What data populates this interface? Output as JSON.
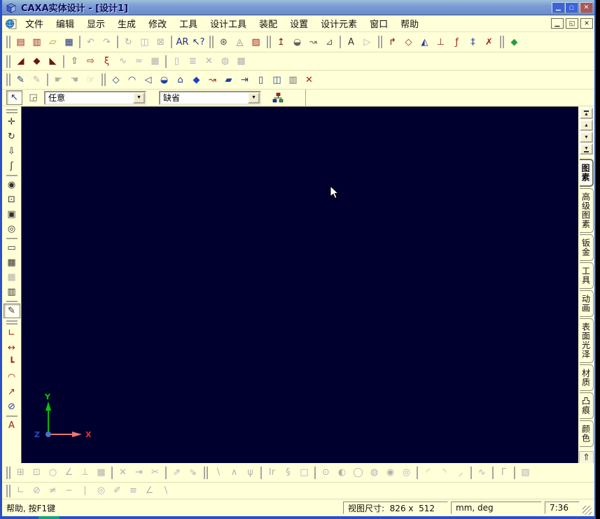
{
  "window": {
    "title": "CAXA实体设计 - [设计1]"
  },
  "titlebar_buttons": [
    {
      "n": "window-minimize",
      "g": "▁"
    },
    {
      "n": "window-maximize",
      "g": "□"
    },
    {
      "n": "window-close",
      "g": "✕"
    }
  ],
  "menubar": {
    "items": [
      {
        "name": "file",
        "label": "文件"
      },
      {
        "name": "edit",
        "label": "编辑"
      },
      {
        "name": "display",
        "label": "显示"
      },
      {
        "name": "generate",
        "label": "生成"
      },
      {
        "name": "modify",
        "label": "修改"
      },
      {
        "name": "tools",
        "label": "工具"
      },
      {
        "name": "design-tools",
        "label": "设计工具"
      },
      {
        "name": "assembly",
        "label": "装配"
      },
      {
        "name": "settings",
        "label": "设置"
      },
      {
        "name": "design-elements",
        "label": "设计元素"
      },
      {
        "name": "window",
        "label": "窗口"
      },
      {
        "name": "help",
        "label": "帮助"
      }
    ],
    "child_buttons": [
      {
        "n": "document-minimize",
        "g": "▁"
      },
      {
        "n": "document-restore",
        "g": "◱"
      },
      {
        "n": "document-close",
        "g": "✕"
      }
    ]
  },
  "toolbars": {
    "standard": [
      {
        "t": "grip"
      },
      {
        "n": "new-design",
        "g": "▤",
        "c": "#a02020"
      },
      {
        "n": "new-drawing",
        "g": "▥",
        "c": "#a02020"
      },
      {
        "n": "open-file",
        "g": "▱",
        "c": "#c09020"
      },
      {
        "n": "save-file",
        "g": "▦",
        "c": "#203080"
      },
      {
        "t": "sep"
      },
      {
        "n": "undo",
        "g": "↶",
        "d": true
      },
      {
        "n": "redo",
        "g": "↷",
        "d": true
      },
      {
        "t": "sep"
      },
      {
        "n": "update-links",
        "g": "↻",
        "d": true
      },
      {
        "n": "copy-multiple",
        "g": "◫",
        "d": true
      },
      {
        "n": "lock-part",
        "g": "⊠",
        "d": true
      },
      {
        "t": "sep"
      },
      {
        "n": "find",
        "g": "AR",
        "c": "#203080"
      },
      {
        "n": "context-help",
        "g": "↖?",
        "c": "#203080"
      },
      {
        "t": "grip"
      },
      {
        "n": "render-options",
        "g": "⊛",
        "c": "#505050"
      },
      {
        "n": "smart-render",
        "g": "◬",
        "c": "#808080"
      },
      {
        "n": "render-scene",
        "g": "▨",
        "c": "#a02020"
      },
      {
        "t": "grip"
      },
      {
        "n": "extrude-wizard",
        "g": "↥",
        "c": "#801010"
      },
      {
        "n": "revolve-wizard",
        "g": "◒",
        "c": "#606060"
      },
      {
        "n": "sweep-wizard",
        "g": "↝",
        "c": "#606060"
      },
      {
        "n": "loft-wizard",
        "g": "⊿",
        "c": "#606060"
      },
      {
        "t": "sep"
      },
      {
        "n": "text-wizard",
        "g": "A",
        "c": "#303030"
      },
      {
        "n": "sketch-wizard",
        "g": "▷",
        "d": true
      },
      {
        "t": "grip"
      },
      {
        "n": "bend-tool",
        "g": "↱",
        "c": "#801010"
      },
      {
        "n": "shell-tool",
        "g": "◇",
        "c": "#a02020"
      },
      {
        "n": "mirror-tool",
        "g": "◭",
        "c": "#2040a0"
      },
      {
        "n": "face-move-tool",
        "g": "⊥",
        "c": "#a02020"
      },
      {
        "n": "equation-tool",
        "g": "ƒ",
        "c": "#a02020"
      },
      {
        "n": "smart-dimension",
        "g": "‡",
        "c": "#2040a0"
      },
      {
        "n": "remove-material",
        "g": "✗",
        "c": "#a02020"
      },
      {
        "t": "grip"
      },
      {
        "n": "surface-tool",
        "g": "◆",
        "c": "#20a040"
      }
    ],
    "feature": [
      {
        "t": "grip"
      },
      {
        "n": "extrude-feature",
        "g": "◢",
        "c": "#6b1515"
      },
      {
        "n": "revolve-feature",
        "g": "◆",
        "c": "#6b1515"
      },
      {
        "n": "sweep-feature",
        "g": "◣",
        "c": "#6b1515"
      },
      {
        "t": "sep"
      },
      {
        "n": "stamp-feature",
        "g": "⇧",
        "c": "#555555"
      },
      {
        "n": "draft-feature",
        "g": "⇨",
        "c": "#a02020"
      },
      {
        "n": "spring-feature",
        "g": "ξ",
        "c": "#a02020"
      },
      {
        "n": "surface-feature-1",
        "g": "∿",
        "d": true
      },
      {
        "n": "surface-feature-2",
        "g": "≈",
        "d": true
      },
      {
        "n": "surface-feature-3",
        "g": "▦",
        "d": true
      },
      {
        "t": "sep"
      },
      {
        "n": "new-sheet",
        "g": "▯",
        "d": true
      },
      {
        "n": "sheet-stack",
        "g": "≣",
        "d": true
      },
      {
        "n": "split-tool",
        "g": "✕",
        "d": true
      },
      {
        "n": "shade-tool",
        "g": "◍",
        "d": true
      },
      {
        "n": "pattern-tool",
        "g": "▩",
        "d": true
      }
    ],
    "wireframe": [
      {
        "t": "grip"
      },
      {
        "n": "sketch-2d",
        "g": "✎",
        "c": "#203080"
      },
      {
        "n": "sketch-3d",
        "g": "✎",
        "d": true
      },
      {
        "t": "sep"
      },
      {
        "n": "drag-handle-1",
        "g": "☛",
        "d": true
      },
      {
        "n": "drag-handle-2",
        "g": "☚",
        "d": true
      },
      {
        "n": "drag-handle-3",
        "g": "☞",
        "d": true
      },
      {
        "t": "grip"
      },
      {
        "n": "wire-box",
        "g": "◇",
        "c": "#2040a0"
      },
      {
        "n": "wire-cylinder",
        "g": "◠",
        "c": "#2040a0"
      },
      {
        "n": "wire-wedge",
        "g": "◁",
        "c": "#2040a0"
      },
      {
        "n": "wire-vase",
        "g": "◒",
        "c": "#2040a0"
      },
      {
        "n": "wire-profile",
        "g": "⌂",
        "c": "#2040a0"
      },
      {
        "n": "solid-box",
        "g": "◆",
        "c": "#2040c0"
      },
      {
        "n": "guide-curve",
        "g": "↝",
        "c": "#a02020"
      },
      {
        "n": "slant-surface",
        "g": "▰",
        "c": "#2040a0"
      },
      {
        "n": "extract-geometry",
        "g": "⇥",
        "c": "#2040a0"
      },
      {
        "n": "annotate-box",
        "g": "▯",
        "c": "#2040a0"
      },
      {
        "n": "mirror-body",
        "g": "◫",
        "c": "#2040a0"
      },
      {
        "n": "copy-body",
        "g": "▥",
        "c": "#707070"
      },
      {
        "n": "delete-body",
        "g": "✕",
        "c": "#a02020"
      }
    ],
    "left": [
      {
        "t": "grip"
      },
      {
        "n": "pan-view",
        "g": "✛",
        "c": "#303030"
      },
      {
        "n": "rotate-view",
        "g": "↻",
        "c": "#303030"
      },
      {
        "n": "zoom-view",
        "g": "⇩",
        "c": "#303030"
      },
      {
        "n": "walk-view",
        "g": "ʃ",
        "c": "#303030"
      },
      {
        "t": "sep"
      },
      {
        "n": "zoom-tool",
        "g": "◉",
        "c": "#303030"
      },
      {
        "n": "zoom-window",
        "g": "⊡",
        "c": "#303030"
      },
      {
        "n": "zoom-extents",
        "g": "▣",
        "c": "#303030"
      },
      {
        "n": "set-target",
        "g": "◎",
        "c": "#303030"
      },
      {
        "t": "sep"
      },
      {
        "n": "view-normal",
        "g": "▭",
        "c": "#303030"
      },
      {
        "n": "camera-view",
        "g": "▦",
        "c": "#303030"
      },
      {
        "n": "camera-capture",
        "g": "▦",
        "d": true
      },
      {
        "n": "camera-pair",
        "g": "▥",
        "c": "#303030"
      },
      {
        "t": "sep"
      },
      {
        "n": "render-mode",
        "g": "✎",
        "c": "#303030",
        "p": true
      },
      {
        "t": "grip"
      },
      {
        "n": "dim-angle",
        "g": "∟",
        "c": "#a02020"
      },
      {
        "n": "dim-width",
        "g": "↔",
        "c": "#a02020"
      },
      {
        "n": "dim-length",
        "g": "┗",
        "c": "#a02020"
      },
      {
        "n": "dim-arc",
        "g": "◠",
        "c": "#a02020"
      },
      {
        "n": "dim-radius",
        "g": "↗",
        "c": "#a02020"
      },
      {
        "n": "dim-diameter",
        "g": "⊘",
        "c": "#2040a0"
      },
      {
        "t": "sep"
      },
      {
        "n": "dim-text",
        "g": "A",
        "c": "#a02020"
      }
    ],
    "sketch": [
      {
        "t": "grip"
      },
      {
        "n": "align-grid",
        "g": "⊞",
        "d": true
      },
      {
        "n": "stretch-box",
        "g": "⊡",
        "d": true
      },
      {
        "n": "rotate-sketch",
        "g": "○",
        "d": true
      },
      {
        "n": "slope-lines",
        "g": "∠",
        "d": true
      },
      {
        "n": "move-profile",
        "g": "⊥",
        "d": true
      },
      {
        "n": "anchor-profile",
        "g": "▦",
        "d": true
      },
      {
        "t": "sep"
      },
      {
        "n": "delete-element",
        "g": "✕",
        "d": true
      },
      {
        "n": "extend-element",
        "g": "⇥",
        "d": true
      },
      {
        "n": "trim-element",
        "g": "✂",
        "d": true
      },
      {
        "t": "sep"
      },
      {
        "n": "project-curve-1",
        "g": "⇗",
        "d": true
      },
      {
        "n": "project-curve-2",
        "g": "⇘",
        "d": true
      },
      {
        "t": "grip"
      },
      {
        "n": "line-tool",
        "g": "∖",
        "d": true
      },
      {
        "n": "tangent-line",
        "g": "∧",
        "d": true
      },
      {
        "n": "fork-line",
        "g": "ψ",
        "d": true
      },
      {
        "t": "sep"
      },
      {
        "n": "two-point-line",
        "g": "Ir",
        "d": true
      },
      {
        "n": "spiral-tool",
        "g": "§",
        "d": true
      },
      {
        "n": "rectangle-tool",
        "g": "□",
        "d": true
      },
      {
        "t": "sep"
      },
      {
        "n": "circle-center",
        "g": "⊙",
        "d": true
      },
      {
        "n": "circle-diameter",
        "g": "◐",
        "d": true
      },
      {
        "n": "circle-2pt",
        "g": "◯",
        "d": true
      },
      {
        "n": "circle-3pt",
        "g": "◍",
        "d": true
      },
      {
        "n": "circle-tangent",
        "g": "◉",
        "d": true
      },
      {
        "n": "circle-ttt",
        "g": "◎",
        "d": true
      },
      {
        "t": "sep"
      },
      {
        "n": "arc-center",
        "g": "◜",
        "d": true
      },
      {
        "n": "arc-3pt",
        "g": "◝",
        "d": true
      },
      {
        "n": "arc-tangent",
        "g": "◞",
        "d": true
      },
      {
        "t": "sep"
      },
      {
        "n": "spline-tool",
        "g": "∿",
        "d": true
      },
      {
        "t": "sep"
      },
      {
        "n": "corner-tool",
        "g": "Γ",
        "d": true
      },
      {
        "t": "sep"
      },
      {
        "n": "hatch-tool",
        "g": "▨",
        "d": true
      }
    ],
    "constraint": [
      {
        "t": "grip"
      },
      {
        "n": "perpendicular-constraint",
        "g": "∟",
        "d": true
      },
      {
        "n": "tangent-constraint",
        "g": "⊘",
        "d": true
      },
      {
        "n": "parallel-constraint",
        "g": "≠",
        "d": true
      },
      {
        "n": "horizontal-constraint",
        "g": "−",
        "d": true
      },
      {
        "n": "vertical-constraint",
        "g": "∣",
        "d": true
      },
      {
        "n": "concentric-constraint",
        "g": "◎",
        "d": true
      },
      {
        "n": "fix-constraint",
        "g": "✐",
        "d": true
      },
      {
        "n": "equal-constraint",
        "g": "≡",
        "d": true
      },
      {
        "n": "angle-constraint",
        "g": "∠",
        "d": true
      },
      {
        "n": "collinear-constraint",
        "g": "∖",
        "d": true
      }
    ]
  },
  "selection_bar": {
    "select_tool_glyph": "↖",
    "select_region_glyph": "◲",
    "style_combo_value": "任意",
    "render_combo_value": "缺省"
  },
  "right_panel": {
    "scroll_buttons": [
      {
        "n": "catalog-scroll-first",
        "g": "▲",
        "cls": "bar-top"
      },
      {
        "n": "catalog-scroll-up",
        "g": "▲"
      },
      {
        "n": "catalog-scroll-down",
        "g": "▼"
      },
      {
        "n": "catalog-scroll-last",
        "g": "▼",
        "cls": "bar-bottom"
      }
    ],
    "tabs": [
      {
        "name": "primitives",
        "label": "图素",
        "active": true
      },
      {
        "name": "advanced-primitives",
        "label": "高级图素"
      },
      {
        "name": "sheet-metal",
        "label": "钣金"
      },
      {
        "name": "tools",
        "label": "工具"
      },
      {
        "name": "animation",
        "label": "动画"
      },
      {
        "name": "surface-finish",
        "label": "表面光泽"
      },
      {
        "name": "material",
        "label": "材质"
      },
      {
        "name": "bump",
        "label": "凸痕"
      },
      {
        "name": "color",
        "label": "颜色"
      }
    ],
    "bottom_buttons": [
      {
        "n": "catalog-insert",
        "g": "⇑",
        "c": "#404040"
      },
      {
        "n": "catalog-extract",
        "g": "▯",
        "c": "#404040"
      }
    ]
  },
  "statusbar": {
    "help_text": "帮助, 按F1键",
    "view_size": "视图尺寸:  826 x  512",
    "units": "mm, deg",
    "time": "7:36"
  },
  "canvas": {
    "background": "#00002e",
    "axes": {
      "x": "X",
      "y": "Y",
      "z": "Z",
      "x_color": "#e03030",
      "y_color": "#00cc00",
      "z_color": "#3048c0"
    }
  },
  "colors": {
    "ui_background": "#ffffd8",
    "titlebar_blue": "#7c9cd6",
    "window_border_blue": "#2a50c8",
    "close_button_red": "#a85a5a",
    "disabled_icon": "#b2b29e"
  }
}
